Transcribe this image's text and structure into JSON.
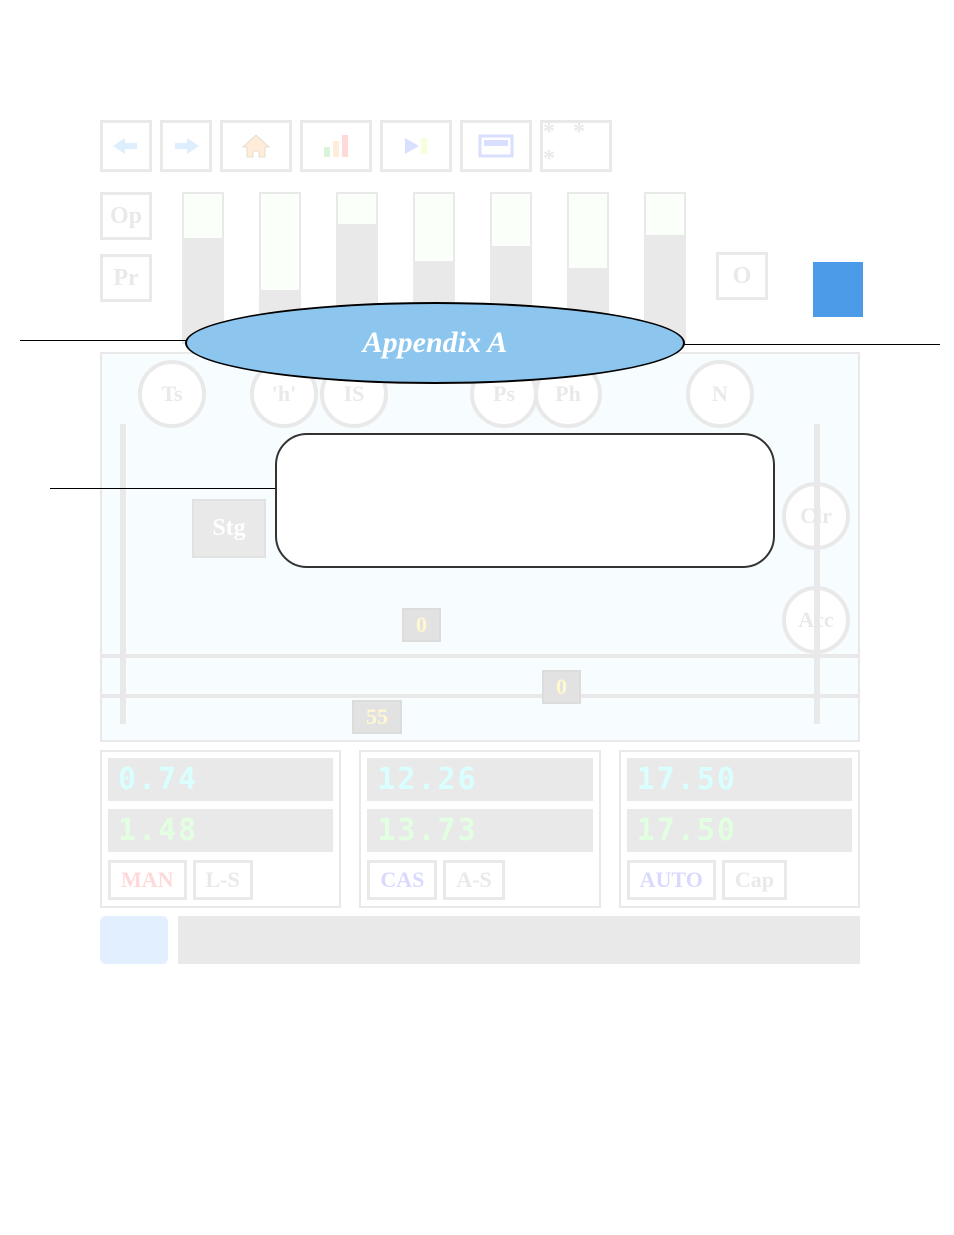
{
  "overlay": {
    "appendix_label": "Appendix A"
  },
  "nav": {
    "back_icon": "←",
    "forward_icon": "→",
    "home_icon": "⌂",
    "chart_icon": "▥",
    "play_icon": "▶",
    "display_icon": "▭",
    "menu_icon": "* * *"
  },
  "side_buttons": {
    "op": "Op",
    "pr": "Pr",
    "of": "O"
  },
  "circle_labels": {
    "ts": "Ts",
    "h": "'h'",
    "is": "IS",
    "ps": "Ps",
    "ph": "Ph",
    "n": "N",
    "clr": "Clr",
    "acc": "Acc"
  },
  "stg_label": "Stg",
  "small_values": {
    "v1": "0",
    "v2": "0",
    "v3": "55"
  },
  "readouts": [
    {
      "top": "0.74",
      "bottom": "1.48",
      "mode1": "MAN",
      "mode2": "L-S"
    },
    {
      "top": "12.26",
      "bottom": "13.73",
      "mode1": "CAS",
      "mode2": "A-S"
    },
    {
      "top": "17.50",
      "bottom": "17.50",
      "mode1": "AUTO",
      "mode2": "Cap"
    }
  ]
}
